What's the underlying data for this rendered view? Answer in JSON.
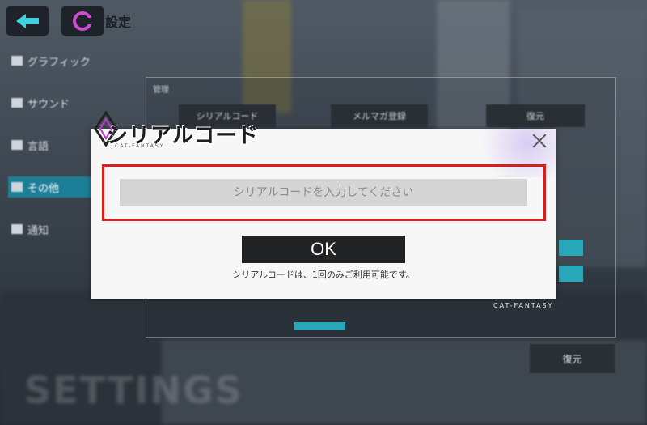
{
  "header": {
    "title": "設定"
  },
  "menu": {
    "items": [
      {
        "label": "グラフィック",
        "icon": "graphics-icon",
        "active": false
      },
      {
        "label": "サウンド",
        "icon": "sound-icon",
        "active": false
      },
      {
        "label": "言語",
        "icon": "language-icon",
        "active": false
      },
      {
        "label": "その他",
        "icon": "other-icon",
        "active": true
      },
      {
        "label": "通知",
        "icon": "notification-icon",
        "active": false
      }
    ]
  },
  "background_panel": {
    "section_label": "管理",
    "buttons": [
      "シリアルコード",
      "メルマガ登録",
      "復元"
    ],
    "restore_button": "復元",
    "watermark": "SETTINGS",
    "brand": "CAT-FANTASY"
  },
  "dialog": {
    "title": "シリアルコード",
    "brand": "CAT-FANTASY",
    "input_placeholder": "シリアルコードを入力してください",
    "input_value": "",
    "ok_label": "OK",
    "note": "シリアルコードは、1回のみご利用可能です。"
  },
  "colors": {
    "highlight": "#d91e1e",
    "active_menu": "#1d7f97",
    "accent_teal": "#27a7b8",
    "button_dark": "#222325"
  }
}
